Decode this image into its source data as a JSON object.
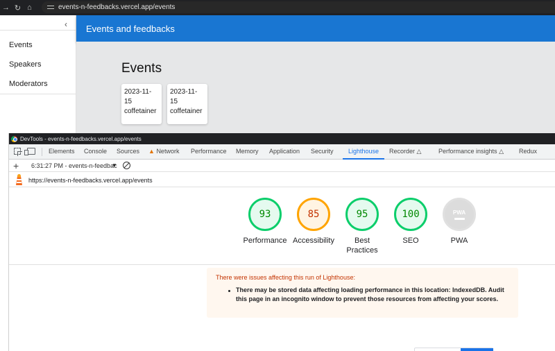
{
  "browser": {
    "url": "events-n-feedbacks.vercel.app/events",
    "icons": [
      "forward-icon",
      "reload-icon",
      "home-icon",
      "site-info-icon"
    ]
  },
  "app": {
    "sidebar_items": [
      "Events",
      "Speakers",
      "Moderators"
    ],
    "header_title": "Events and feedbacks",
    "page_title": "Events",
    "events": [
      {
        "date": "2023-11-15",
        "name": "coffetainer"
      },
      {
        "date": "2023-11-15",
        "name": "coffetainer"
      }
    ],
    "colors": {
      "header": "#1976d2",
      "content_bg": "#e6e7e8"
    }
  },
  "devtools": {
    "title": "DevTools - events-n-feedbacks.vercel.app/events",
    "tabs": [
      "Elements",
      "Console",
      "Sources",
      "Network",
      "Performance",
      "Memory",
      "Application",
      "Security",
      "Lighthouse",
      "Recorder",
      "Performance insights",
      "Redux"
    ],
    "active_tab": "Lighthouse",
    "run_label": "6:31:27 PM - events-n-feedbac",
    "report_url": "https://events-n-feedbacks.vercel.app/events",
    "scores": [
      {
        "label": "Performance",
        "value": "93",
        "status": "pass"
      },
      {
        "label": "Accessibility",
        "value": "85",
        "status": "average"
      },
      {
        "label": "Best Practices",
        "value": "95",
        "status": "pass"
      },
      {
        "label": "SEO",
        "value": "100",
        "status": "pass"
      },
      {
        "label": "PWA",
        "value": "PWA",
        "status": "na"
      }
    ],
    "warning_title": "There were issues affecting this run of Lighthouse:",
    "warning_items": [
      "There may be stored data affecting loading performance in this location: IndexedDB. Audit this page in an incognito window to prevent those resources from affecting your scores."
    ],
    "colors": {
      "pass": "#0cce6b",
      "average": "#ffa400",
      "accent": "#1a73e8",
      "warning_text": "#c33300"
    }
  }
}
